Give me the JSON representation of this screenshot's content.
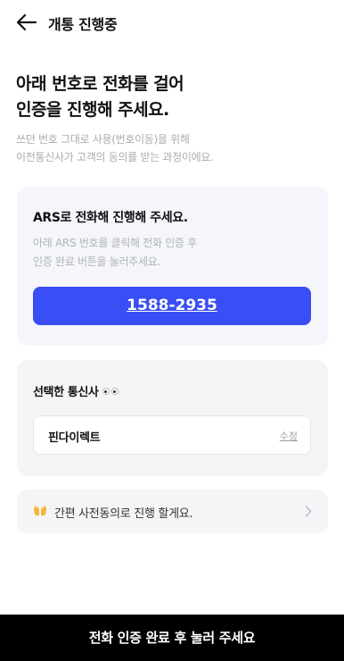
{
  "header": {
    "title": "개통 진행중"
  },
  "intro": {
    "headline_line1": "아래 번호로 전화를 걸어",
    "headline_line2": "인증을 진행해 주세요.",
    "sub_line1": "쓰던 번호 그대로 사용(번호이동)을 위해",
    "sub_line2": "이전통신사가 고객의 동의를 받는 과정이에요."
  },
  "ars": {
    "title": "ARS로 전화해 진행해 주세요.",
    "desc_line1": "아래 ARS 번호를 클릭해 전화 인증 후",
    "desc_line2": "인증 완료 버튼을 눌러주세요.",
    "phone": "1588-2935",
    "accent": "#3a4ef5"
  },
  "carrier": {
    "title": "선택한 통신사",
    "name": "핀다이렉트",
    "edit_label": "수정"
  },
  "simple": {
    "label": "간편 사전동의로 진행 할게요."
  },
  "bottom": {
    "label": "전화 인증 완료 후 눌러 주세요"
  }
}
